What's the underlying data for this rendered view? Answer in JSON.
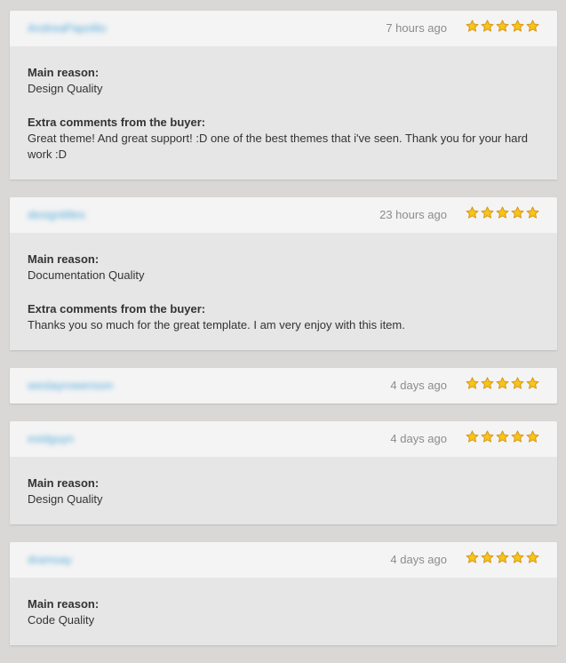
{
  "colors": {
    "page_background": "#d9d8d6",
    "header_background": "#f4f4f4",
    "body_background": "#e6e6e6",
    "reviewer_link": "#3a9fd8",
    "timestamp": "#8c8c8c",
    "star_fill": "#f5c518",
    "star_stroke": "#d8951a"
  },
  "labels": {
    "main_reason": "Main reason:",
    "extra_comments": "Extra comments from the buyer:"
  },
  "reviews": [
    {
      "reviewer": "AndreaPapolito",
      "time": "7 hours ago",
      "rating": 5,
      "main_reason": "Design Quality",
      "comments": "Great theme! And great support! :D one of the best themes that i've seen. Thank you for your hard work :D"
    },
    {
      "reviewer": "designtitles",
      "time": "23 hours ago",
      "rating": 5,
      "main_reason": "Documentation Quality",
      "comments": "Thanks you so much for the great template. I am very enjoy with this item."
    },
    {
      "reviewer": "weslayrowenson",
      "time": "4 days ago",
      "rating": 5
    },
    {
      "reviewer": "esidguyn",
      "time": "4 days ago",
      "rating": 5,
      "main_reason": "Design Quality"
    },
    {
      "reviewer": "dramsay",
      "time": "4 days ago",
      "rating": 5,
      "main_reason": "Code Quality"
    }
  ]
}
